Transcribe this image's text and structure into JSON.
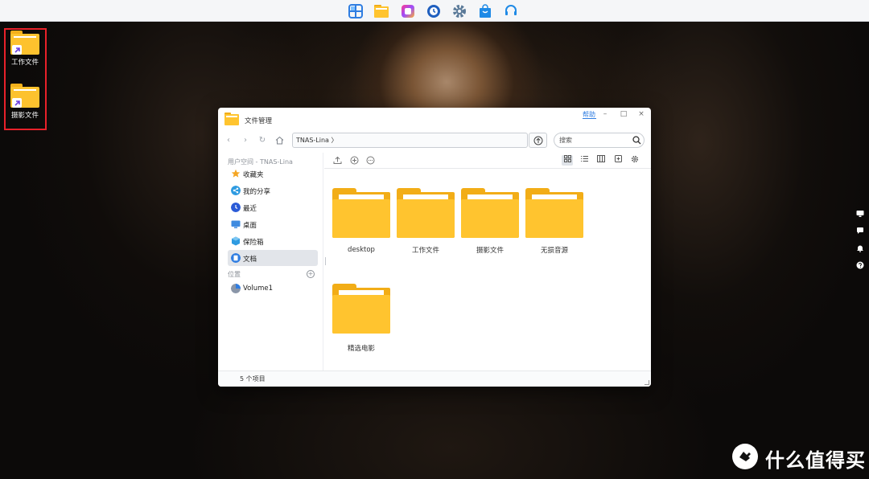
{
  "dock": {
    "icons": [
      "control-panel-icon",
      "file-manager-icon",
      "photos-icon",
      "backup-icon",
      "settings-icon",
      "app-center-icon",
      "support-icon"
    ]
  },
  "desktop": {
    "shortcuts": [
      {
        "label": "工作文件"
      },
      {
        "label": "摄影文件"
      }
    ]
  },
  "window": {
    "title": "文件管理",
    "help": "帮助",
    "controls": {
      "minimize": "–",
      "maximize": "□",
      "close": "×"
    },
    "path": "TNAS-Lina  〉",
    "search_placeholder": "搜索",
    "sidebar": {
      "user_space_header": "用户空间 - TNAS-Lina",
      "items": [
        {
          "label": "收藏夹",
          "color": "#f5a623"
        },
        {
          "label": "我的分享",
          "color": "#2f7de1"
        },
        {
          "label": "最近",
          "color": "#2a5bd7"
        },
        {
          "label": "桌面",
          "color": "#3f8be0"
        },
        {
          "label": "保险箱",
          "color": "#2f9be1"
        },
        {
          "label": "文档",
          "color": "#2f7de1"
        }
      ],
      "location_header": "位置",
      "locations": [
        {
          "label": "Volume1"
        }
      ]
    },
    "files": [
      {
        "name": "desktop"
      },
      {
        "name": "工作文件"
      },
      {
        "name": "摄影文件"
      },
      {
        "name": "无损音源"
      },
      {
        "name": "精选电影"
      }
    ],
    "status": "5 个项目"
  },
  "watermark": {
    "text": "什么值得买"
  }
}
